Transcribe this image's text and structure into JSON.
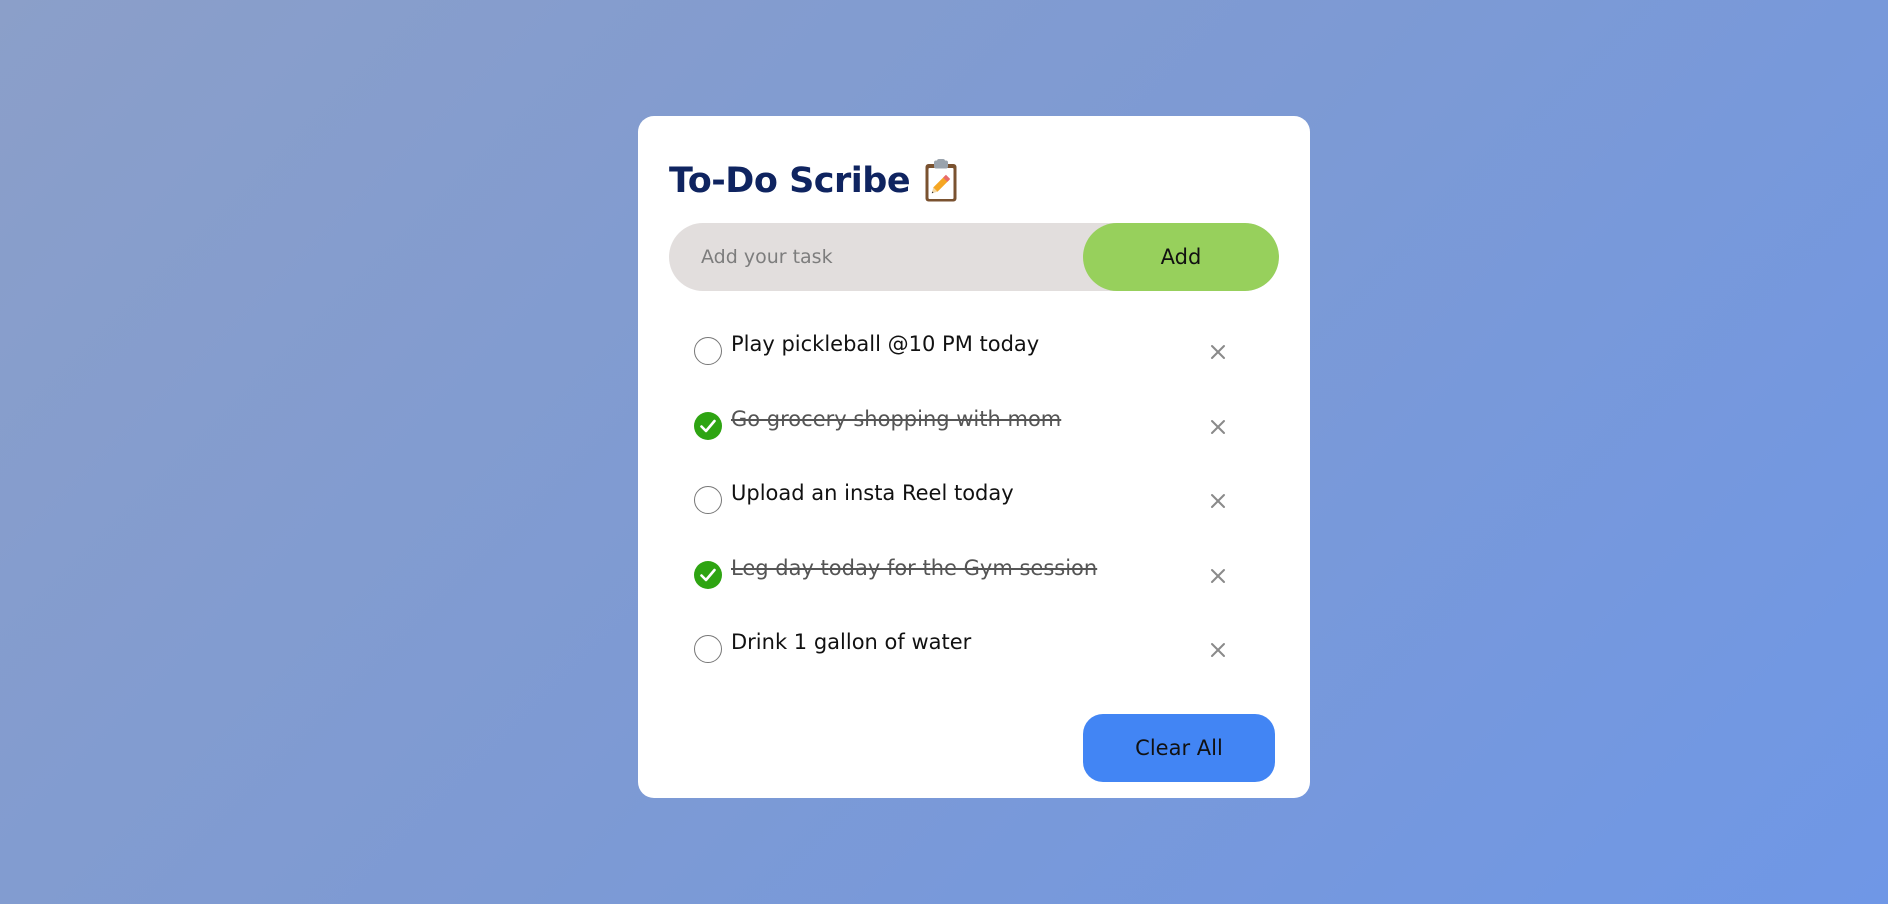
{
  "app": {
    "title": "To-Do Scribe",
    "title_icon": "clipboard-pencil-icon"
  },
  "input": {
    "placeholder": "Add your task",
    "value": "",
    "add_label": "Add"
  },
  "tasks": [
    {
      "text": "Play pickleball @10 PM today",
      "done": false
    },
    {
      "text": "Go grocery shopping with mom",
      "done": true
    },
    {
      "text": "Upload an insta Reel today",
      "done": false
    },
    {
      "text": "Leg day today for the Gym session",
      "done": true
    },
    {
      "text": "Drink 1 gallon of water",
      "done": false
    }
  ],
  "clear_all_label": "Clear All",
  "colors": {
    "title": "#0f2460",
    "add_button": "#97d05c",
    "clear_button": "#4285f4",
    "checked": "#2ea412",
    "input_bg": "#e2dedd"
  }
}
